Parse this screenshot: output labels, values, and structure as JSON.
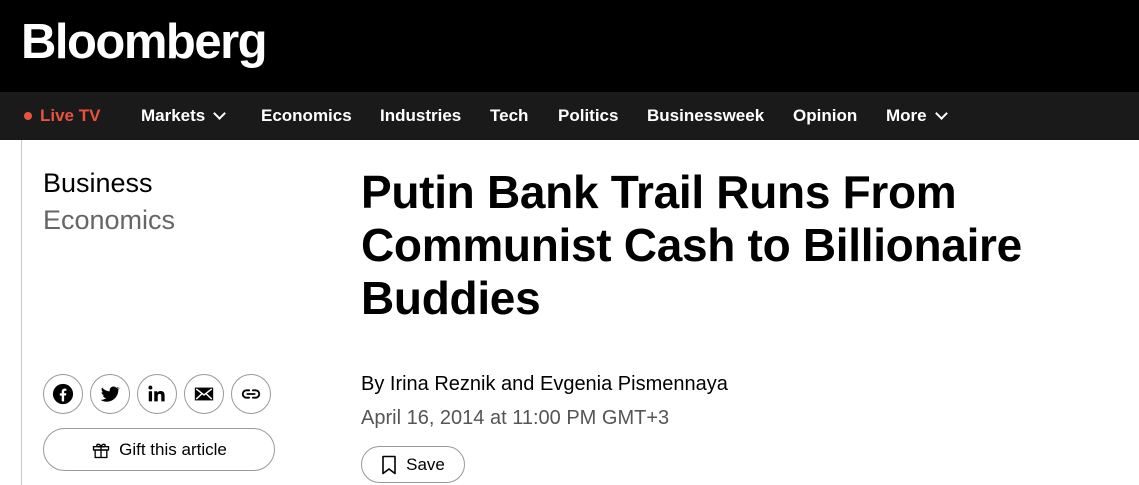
{
  "brand": {
    "logo": "Bloomberg"
  },
  "nav": {
    "live": "Live TV",
    "items": [
      "Markets",
      "Economics",
      "Industries",
      "Tech",
      "Politics",
      "Businessweek",
      "Opinion",
      "More"
    ]
  },
  "article": {
    "categories": [
      "Business",
      "Economics"
    ],
    "headline": "Putin Bank Trail Runs From Communist Cash to Billionaire Buddies",
    "byline": "By Irina Reznik and Evgenia Pismennaya",
    "date": "April 16, 2014 at 11:00 PM GMT+3"
  },
  "share": {
    "icons": [
      "facebook-icon",
      "twitter-icon",
      "linkedin-icon",
      "email-icon",
      "link-icon"
    ],
    "gift_label": "Gift this article"
  },
  "actions": {
    "save_label": "Save"
  },
  "colors": {
    "live": "#e9533c",
    "topbar": "#000000",
    "navbar": "#1a1a1a"
  }
}
